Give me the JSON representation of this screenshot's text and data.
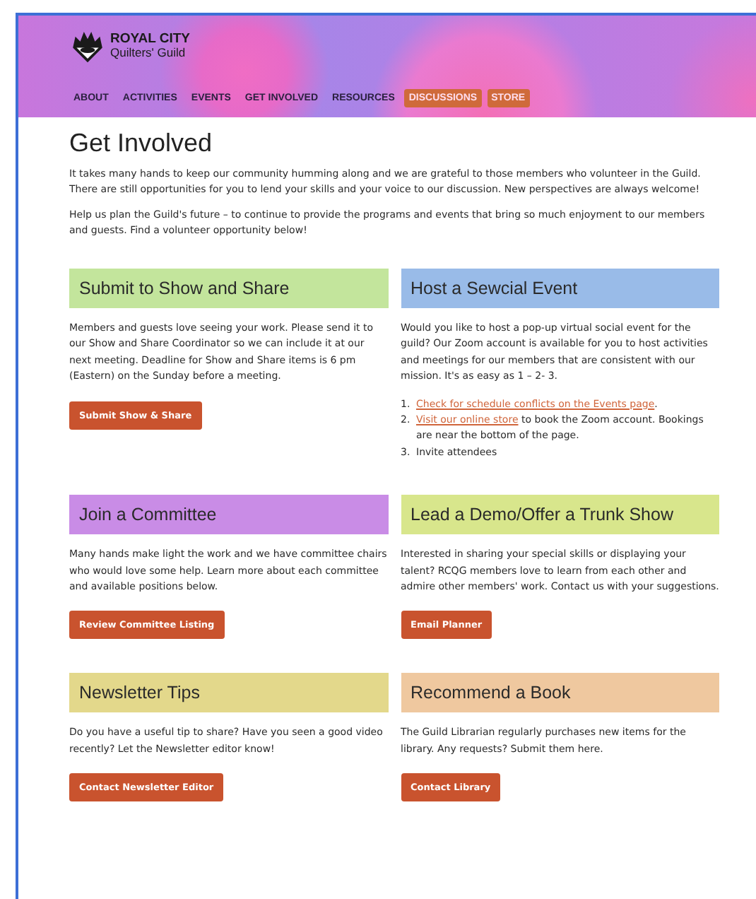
{
  "header": {
    "logo": {
      "line1": "ROYAL CITY",
      "line2": "Quilters' Guild"
    },
    "nav": [
      {
        "label": "ABOUT",
        "highlighted": false
      },
      {
        "label": "ACTIVITIES",
        "highlighted": false
      },
      {
        "label": "EVENTS",
        "highlighted": false
      },
      {
        "label": "GET INVOLVED",
        "highlighted": false
      },
      {
        "label": "RESOURCES",
        "highlighted": false
      },
      {
        "label": "DISCUSSIONS",
        "highlighted": true
      },
      {
        "label": "STORE",
        "highlighted": true
      }
    ]
  },
  "page_title": "Get Involved",
  "intro": [
    "It takes many hands to keep our community humming along and we are grateful to those members who volunteer in the Guild. There are still opportunities for you to lend your skills and your voice to our discussion. New perspectives are always welcome!",
    "Help us plan the Guild's future – to continue to provide the programs and events that bring so much enjoyment to our members and guests. Find a volunteer opportunity below!"
  ],
  "cards": [
    {
      "title": "Submit to Show and Share",
      "color": "#c3e59c",
      "kind": "text",
      "text": "Members and guests love seeing your work. Please send it to our Show and Share Coordinator so we can include it at our next meeting. Deadline for Show and Share items is 6 pm (Eastern) on the Sunday before a meeting.",
      "button": "Submit Show & Share"
    },
    {
      "title": "Host a Sewcial Event",
      "color": "#99bbe8",
      "kind": "steps",
      "text": "Would you like to host a pop-up virtual social event for the guild? Our Zoom account is available for you to host activities and meetings for our members that are consistent with our mission. It's as easy as 1 – 2- 3.",
      "steps": [
        {
          "number": "1.",
          "link": "Check for schedule conflicts on the Events page",
          "text": "."
        },
        {
          "number": "2.",
          "link": "Visit our online store",
          "text": " to book the Zoom account. Bookings are near the bottom of the page."
        },
        {
          "number": "3.",
          "text": "Invite attendees"
        }
      ]
    },
    {
      "title": "Join a Committee",
      "color": "#c98ce6",
      "kind": "text",
      "text": "Many hands make light the work and we have committee chairs who would love some help. Learn more about each committee and available positions below.",
      "button": "Review Committee Listing"
    },
    {
      "title": "Lead a Demo/Offer a Trunk Show",
      "color": "#d8e68c",
      "kind": "text",
      "text": "Interested in sharing your special skills or displaying your talent? RCQG members love to learn from each other and admire other members' work. Contact us with your suggestions.",
      "button": "Email Planner"
    },
    {
      "title": "Newsletter Tips",
      "color": "#e3d88b",
      "kind": "text",
      "text": "Do you have a useful tip to share? Have you seen a good video recently? Let the Newsletter editor know!",
      "button": "Contact Newsletter Editor"
    },
    {
      "title": "Recommend a Book",
      "color": "#efc89f",
      "kind": "text",
      "text": "The Guild Librarian regularly purchases new items for the library. Any requests? Submit them here.",
      "button": "Contact Library"
    }
  ]
}
